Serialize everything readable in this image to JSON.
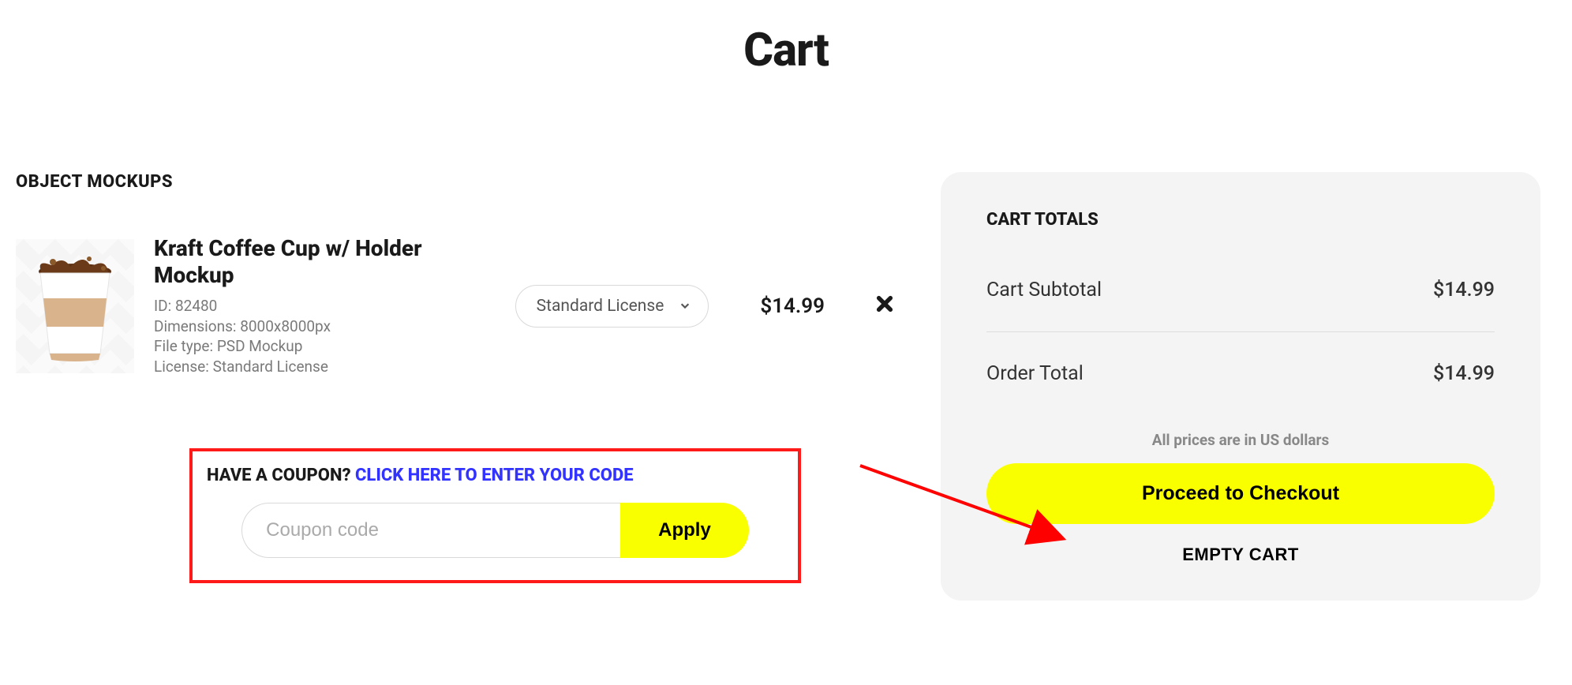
{
  "page_title": "Cart",
  "section_heading": "OBJECT MOCKUPS",
  "item": {
    "title": "Kraft Coffee Cup w/ Holder Mockup",
    "id_label": "ID:",
    "id_value": "82480",
    "dimensions_label": "Dimensions:",
    "dimensions_value": "8000x8000px",
    "filetype_label": "File type:",
    "filetype_value": "PSD Mockup",
    "license_label": "License:",
    "license_value": "Standard License",
    "license_selected": "Standard License",
    "price": "$14.99"
  },
  "coupon": {
    "prompt": "HAVE A COUPON? ",
    "link_text": "CLICK HERE TO ENTER YOUR CODE",
    "placeholder": "Coupon code",
    "apply_label": "Apply"
  },
  "totals": {
    "heading": "CART TOTALS",
    "subtotal_label": "Cart Subtotal",
    "subtotal_value": "$14.99",
    "order_label": "Order Total",
    "order_value": "$14.99",
    "prices_note": "All prices are in US dollars",
    "checkout_label": "Proceed to Checkout",
    "empty_label": "EMPTY CART"
  }
}
